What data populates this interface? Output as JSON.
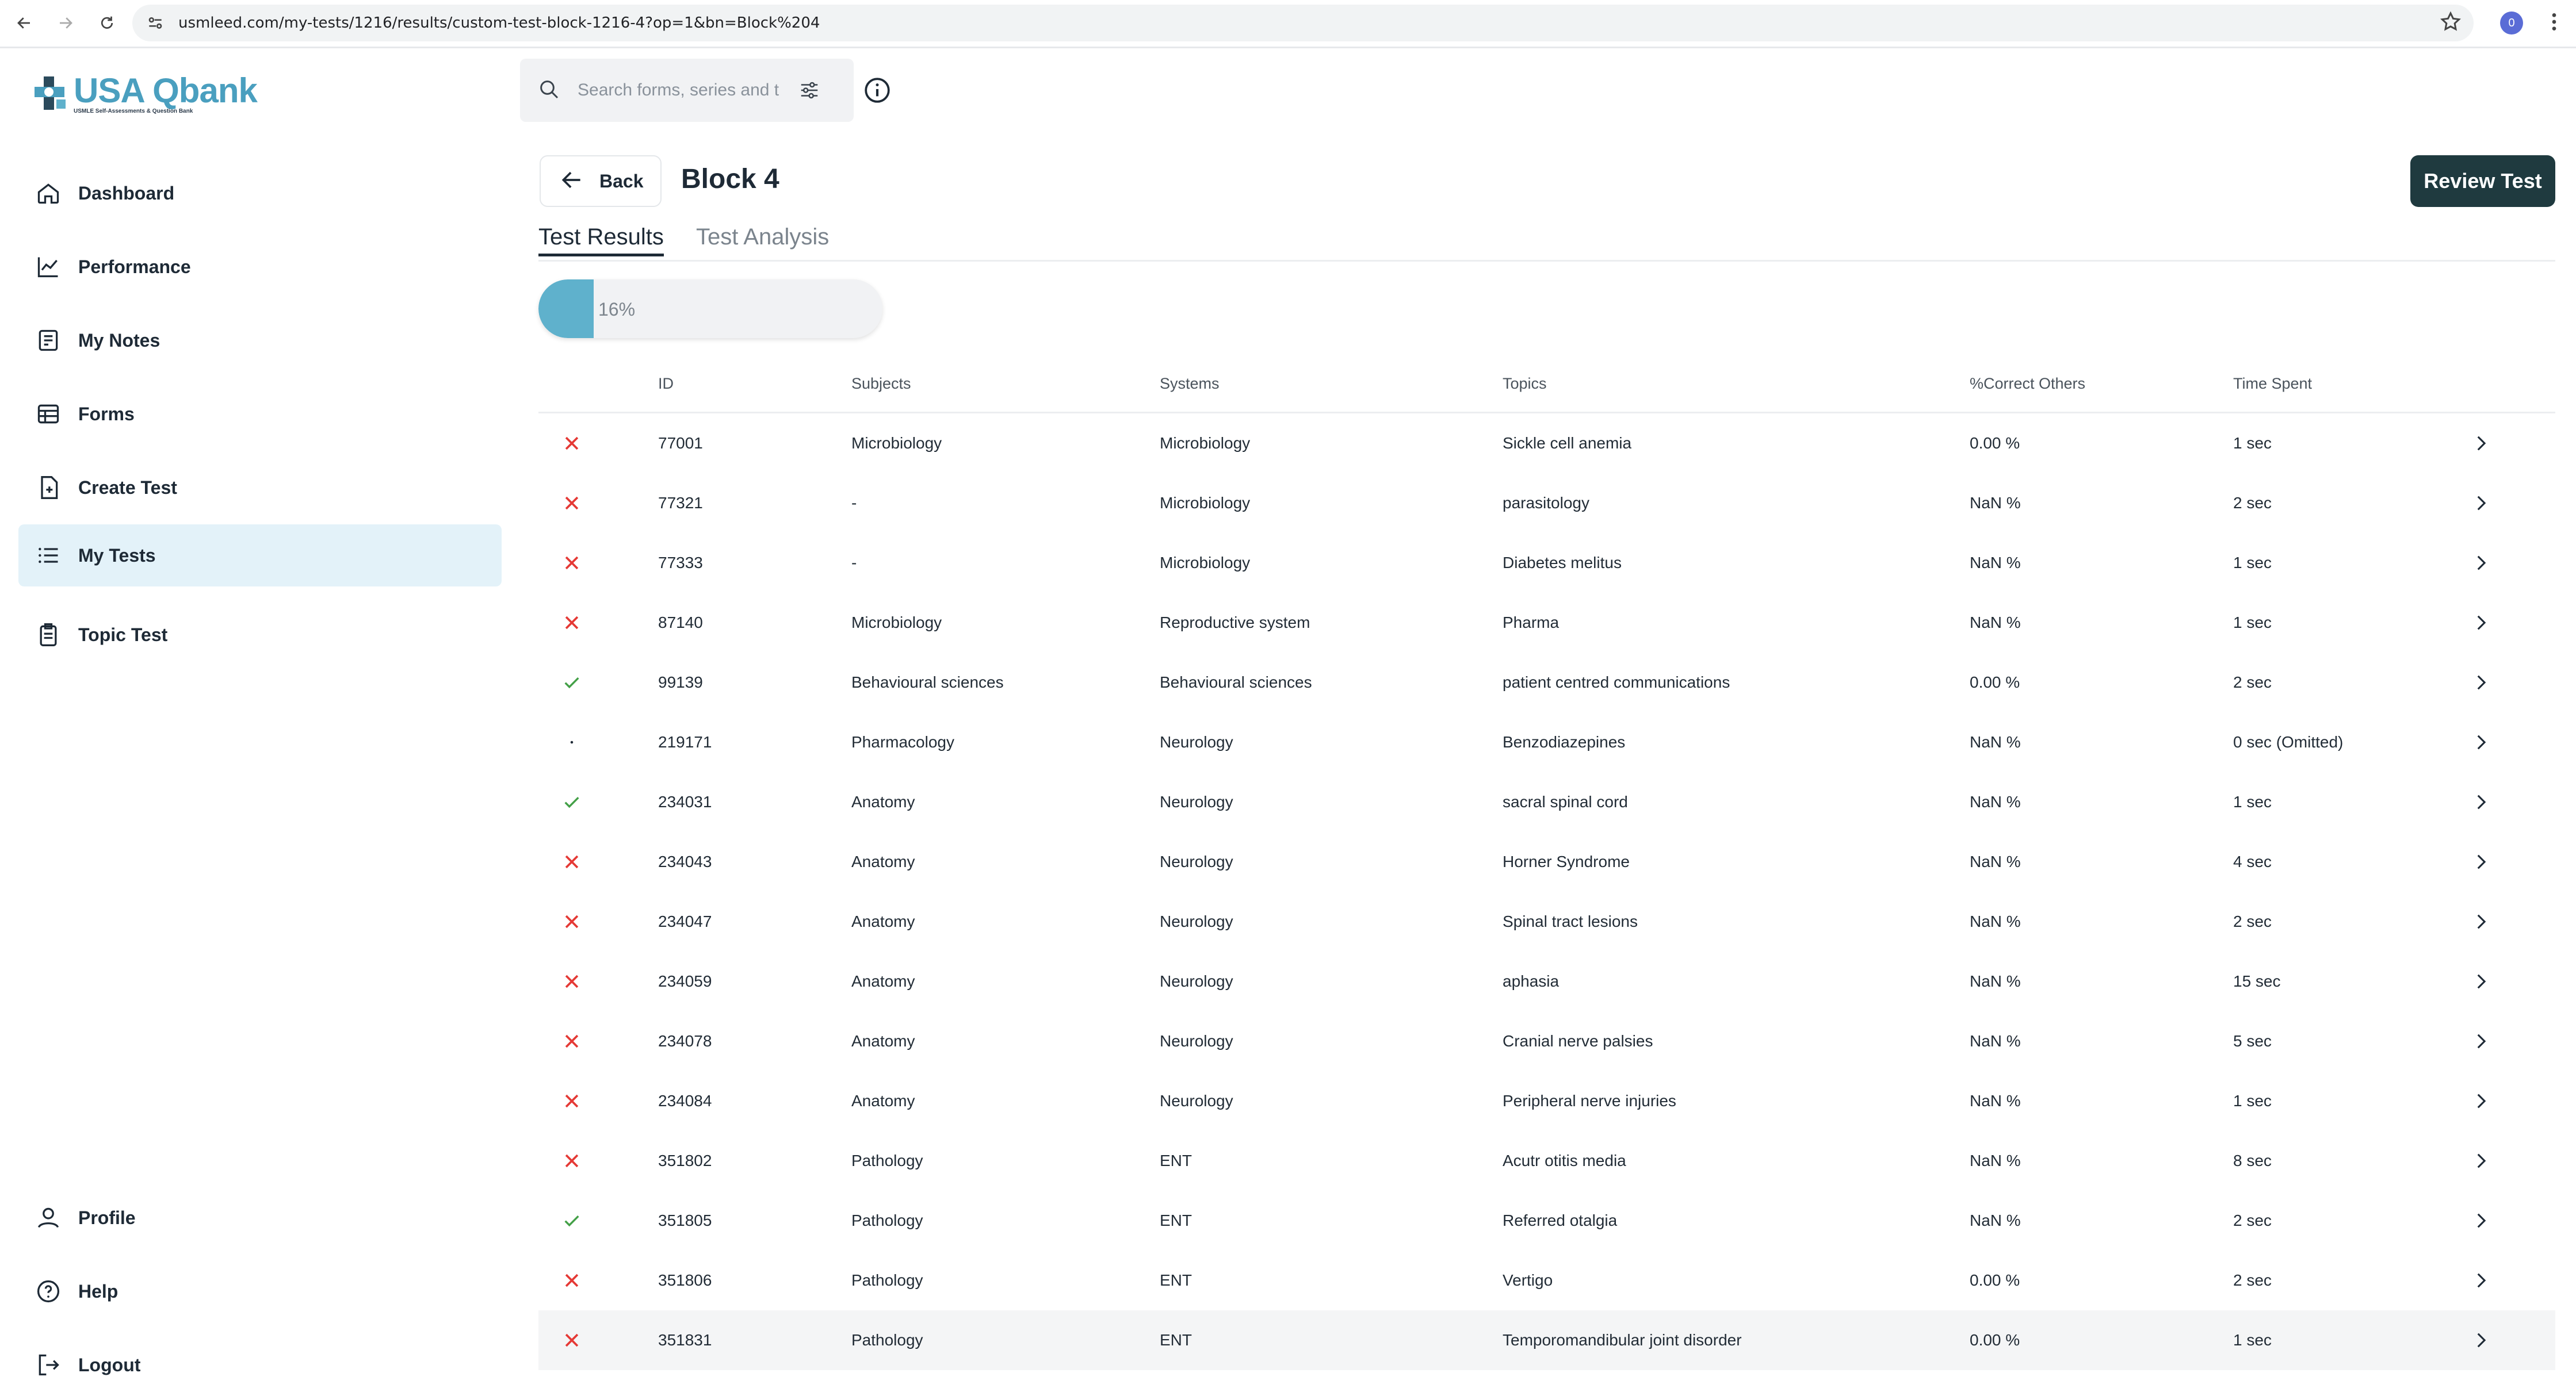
{
  "browser": {
    "url": "usmleed.com/my-tests/1216/results/custom-test-block-1216-4?op=1&bn=Block%204",
    "profile_initial": "0"
  },
  "logo": {
    "title": "USA Qbank",
    "subtitle": "USMLE Self-Assessments & Question Bank"
  },
  "sidebar": {
    "items": [
      {
        "label": "Dashboard",
        "icon": "home-icon"
      },
      {
        "label": "Performance",
        "icon": "chart-icon"
      },
      {
        "label": "My Notes",
        "icon": "notes-icon"
      },
      {
        "label": "Forms",
        "icon": "forms-icon"
      },
      {
        "label": "Create Test",
        "icon": "create-test-icon"
      },
      {
        "label": "My Tests",
        "icon": "list-icon",
        "active": true
      },
      {
        "label": "Topic Test",
        "icon": "topic-test-icon"
      }
    ],
    "bottom": [
      {
        "label": "Profile",
        "icon": "user-icon"
      },
      {
        "label": "Help",
        "icon": "help-icon"
      },
      {
        "label": "Logout",
        "icon": "logout-icon"
      }
    ]
  },
  "search": {
    "placeholder": "Search forms, series and t"
  },
  "header": {
    "back_label": "Back",
    "title": "Block 4",
    "review_label": "Review Test"
  },
  "tabs": [
    {
      "label": "Test Results",
      "active": true
    },
    {
      "label": "Test Analysis"
    }
  ],
  "progress": {
    "percent": 16,
    "label": "16%"
  },
  "table": {
    "columns": [
      "ID",
      "Subjects",
      "Systems",
      "Topics",
      "%Correct Others",
      "Time Spent"
    ],
    "rows": [
      {
        "status": "incorrect",
        "id": "77001",
        "subject": "Microbiology",
        "system": "Microbiology",
        "topic": "Sickle cell anemia",
        "pct": "0.00 %",
        "time": "1 sec"
      },
      {
        "status": "incorrect",
        "id": "77321",
        "subject": "-",
        "system": "Microbiology",
        "topic": "parasitology",
        "pct": "NaN %",
        "time": "2 sec"
      },
      {
        "status": "incorrect",
        "id": "77333",
        "subject": "-",
        "system": "Microbiology",
        "topic": "Diabetes melitus",
        "pct": "NaN %",
        "time": "1 sec"
      },
      {
        "status": "incorrect",
        "id": "87140",
        "subject": "Microbiology",
        "system": "Reproductive system",
        "topic": "Pharma",
        "pct": "NaN %",
        "time": "1 sec"
      },
      {
        "status": "correct",
        "id": "99139",
        "subject": "Behavioural sciences",
        "system": "Behavioural sciences",
        "topic": "patient centred communications",
        "pct": "0.00 %",
        "time": "2 sec"
      },
      {
        "status": "omitted",
        "id": "219171",
        "subject": "Pharmacology",
        "system": "Neurology",
        "topic": "Benzodiazepines",
        "pct": "NaN %",
        "time": "0 sec (Omitted)"
      },
      {
        "status": "correct",
        "id": "234031",
        "subject": "Anatomy",
        "system": "Neurology",
        "topic": "sacral spinal cord",
        "pct": "NaN %",
        "time": "1 sec"
      },
      {
        "status": "incorrect",
        "id": "234043",
        "subject": "Anatomy",
        "system": "Neurology",
        "topic": "Horner Syndrome",
        "pct": "NaN %",
        "time": "4 sec"
      },
      {
        "status": "incorrect",
        "id": "234047",
        "subject": "Anatomy",
        "system": "Neurology",
        "topic": "Spinal tract lesions",
        "pct": "NaN %",
        "time": "2 sec"
      },
      {
        "status": "incorrect",
        "id": "234059",
        "subject": "Anatomy",
        "system": "Neurology",
        "topic": "aphasia",
        "pct": "NaN %",
        "time": "15 sec"
      },
      {
        "status": "incorrect",
        "id": "234078",
        "subject": "Anatomy",
        "system": "Neurology",
        "topic": "Cranial nerve palsies",
        "pct": "NaN %",
        "time": "5 sec"
      },
      {
        "status": "incorrect",
        "id": "234084",
        "subject": "Anatomy",
        "system": "Neurology",
        "topic": "Peripheral nerve injuries",
        "pct": "NaN %",
        "time": "1 sec"
      },
      {
        "status": "incorrect",
        "id": "351802",
        "subject": "Pathology",
        "system": "ENT",
        "topic": "Acutr otitis media",
        "pct": "NaN %",
        "time": "8 sec"
      },
      {
        "status": "correct",
        "id": "351805",
        "subject": "Pathology",
        "system": "ENT",
        "topic": "Referred otalgia",
        "pct": "NaN %",
        "time": "2 sec"
      },
      {
        "status": "incorrect",
        "id": "351806",
        "subject": "Pathology",
        "system": "ENT",
        "topic": "Vertigo",
        "pct": "0.00 %",
        "time": "2 sec"
      },
      {
        "status": "incorrect",
        "id": "351831",
        "subject": "Pathology",
        "system": "ENT",
        "topic": "Temporomandibular joint disorder",
        "pct": "0.00 %",
        "time": "1 sec",
        "highlighted": true
      }
    ]
  },
  "colors": {
    "accent": "#5fb1cc",
    "incorrect": "#e53935",
    "correct": "#43a047",
    "review_bg": "#1f3a3f",
    "active_bg": "#e3f2f9"
  }
}
